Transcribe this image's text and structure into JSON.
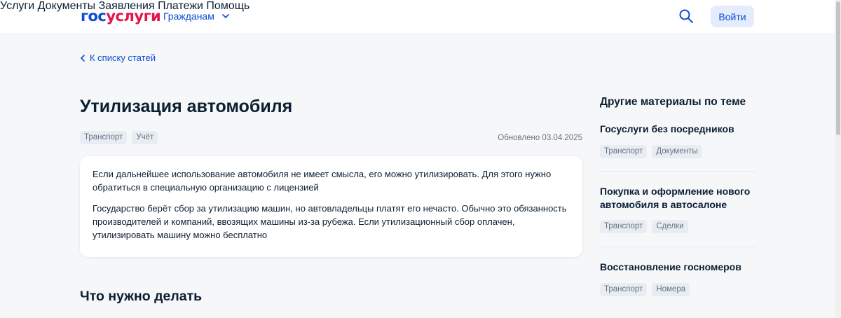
{
  "header": {
    "logo_part1": "гос",
    "logo_part2": "услуги",
    "role": "Гражданам",
    "nav": [
      "Услуги",
      "Документы",
      "Заявления",
      "Платежи",
      "Помощь"
    ],
    "search_icon": "search-icon",
    "login_label": "Войти"
  },
  "article": {
    "back_label": "К списку статей",
    "title": "Утилизация автомобиля",
    "tags": [
      "Транспорт",
      "Учёт"
    ],
    "updated": "Обновлено 03.04.2025",
    "paragraphs": [
      "Если дальнейшее использование автомобиля не имеет смысла, его можно утилизировать. Для этого нужно обратиться в специальную организацию с лицензией",
      "Государство берёт сбор за утилизацию машин, но автовладельцы платят его нечасто. Обычно это обязанность производителей и компаний, ввозящих машины из-за рубежа. Если утилизационный сбор оплачен, утилизировать машину можно бесплатно"
    ],
    "section_title": "Что нужно делать"
  },
  "aside": {
    "title": "Другие материалы по теме",
    "items": [
      {
        "title": "Госуслуги без посредников",
        "tags": [
          "Транспорт",
          "Документы"
        ]
      },
      {
        "title": "Покупка и оформление нового автомобиля в автосалоне",
        "tags": [
          "Транспорт",
          "Сделки"
        ]
      },
      {
        "title": "Восстановление госномеров",
        "tags": [
          "Транспорт",
          "Номера"
        ]
      }
    ]
  },
  "colors": {
    "brand_blue": "#0d4cd3",
    "brand_red": "#e3154d",
    "background": "#f6f7f9",
    "tag_bg": "#e8edf3"
  }
}
